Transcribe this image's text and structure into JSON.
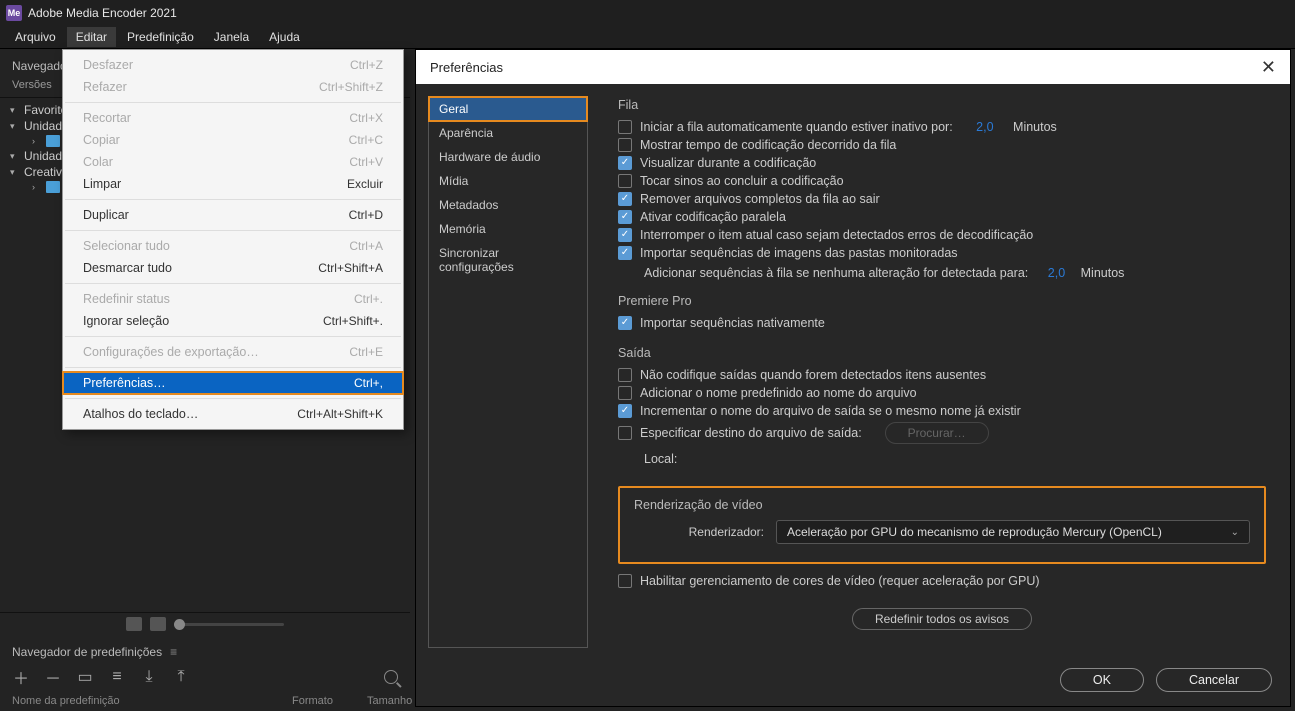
{
  "app": {
    "icon_text": "Me",
    "title": "Adobe Media Encoder 2021"
  },
  "menubar": [
    "Arquivo",
    "Editar",
    "Predefinição",
    "Janela",
    "Ajuda"
  ],
  "edit_menu": {
    "groups": [
      [
        {
          "label": "Desfazer",
          "shortcut": "Ctrl+Z",
          "disabled": true
        },
        {
          "label": "Refazer",
          "shortcut": "Ctrl+Shift+Z",
          "disabled": true
        }
      ],
      [
        {
          "label": "Recortar",
          "shortcut": "Ctrl+X",
          "disabled": true
        },
        {
          "label": "Copiar",
          "shortcut": "Ctrl+C",
          "disabled": true
        },
        {
          "label": "Colar",
          "shortcut": "Ctrl+V",
          "disabled": true
        },
        {
          "label": "Limpar",
          "shortcut": "Excluir",
          "disabled": false
        }
      ],
      [
        {
          "label": "Duplicar",
          "shortcut": "Ctrl+D",
          "disabled": false
        }
      ],
      [
        {
          "label": "Selecionar tudo",
          "shortcut": "Ctrl+A",
          "disabled": true
        },
        {
          "label": "Desmarcar tudo",
          "shortcut": "Ctrl+Shift+A",
          "disabled": false
        }
      ],
      [
        {
          "label": "Redefinir status",
          "shortcut": "Ctrl+.",
          "disabled": true
        },
        {
          "label": "Ignorar seleção",
          "shortcut": "Ctrl+Shift+.",
          "disabled": false
        }
      ],
      [
        {
          "label": "Configurações de exportação…",
          "shortcut": "Ctrl+E",
          "disabled": true
        }
      ],
      [
        {
          "label": "Preferências…",
          "shortcut": "Ctrl+,",
          "disabled": false,
          "highlight": true
        }
      ],
      [
        {
          "label": "Atalhos do teclado…",
          "shortcut": "Ctrl+Alt+Shift+K",
          "disabled": false
        }
      ]
    ]
  },
  "side": {
    "panel_title": "Navegador",
    "versions_label": "Versões",
    "tree": [
      {
        "label": "Favoritos",
        "caret": "▾"
      },
      {
        "label": "Unidades",
        "caret": "▾"
      },
      {
        "label": "",
        "caret": "›",
        "child": true,
        "icon": true
      },
      {
        "label": "Unidades",
        "caret": "▾"
      },
      {
        "label": "Creative",
        "caret": "▾"
      },
      {
        "label": "",
        "caret": "›",
        "child": true,
        "icon": true
      }
    ],
    "preset_browser_title": "Navegador de predefinições",
    "cols": {
      "name": "Nome da predefinição",
      "format": "Formato",
      "size": "Tamanho"
    }
  },
  "dialog": {
    "title": "Preferências",
    "categories": [
      "Geral",
      "Aparência",
      "Hardware de áudio",
      "Mídia",
      "Metadados",
      "Memória",
      "Sincronizar configurações"
    ],
    "selected_category": "Geral",
    "fila": {
      "heading": "Fila",
      "auto_start": {
        "label": "Iniciar a fila automaticamente quando estiver inativo por:",
        "value": "2,0",
        "unit": "Minutos",
        "checked": false
      },
      "show_elapsed": {
        "label": "Mostrar tempo de codificação decorrido da fila",
        "checked": false
      },
      "preview": {
        "label": "Visualizar durante a codificação",
        "checked": true
      },
      "sounds": {
        "label": "Tocar sinos ao concluir a codificação",
        "checked": false
      },
      "remove_done": {
        "label": "Remover arquivos completos da fila ao sair",
        "checked": true
      },
      "parallel": {
        "label": "Ativar codificação paralela",
        "checked": true
      },
      "stop_on_err": {
        "label": "Interromper o item atual caso sejam detectados erros de decodificação",
        "checked": true
      },
      "import_seq": {
        "label": "Importar sequências de imagens das pastas monitoradas",
        "checked": true
      },
      "add_seq_label": "Adicionar sequências à fila se nenhuma alteração for detectada para:",
      "add_seq_value": "2,0",
      "add_seq_unit": "Minutos"
    },
    "premiere": {
      "heading": "Premiere Pro",
      "native": {
        "label": "Importar sequências nativamente",
        "checked": true
      }
    },
    "saida": {
      "heading": "Saída",
      "no_encode_missing": {
        "label": "Não codifique saídas quando forem detectados itens ausentes",
        "checked": false
      },
      "add_preset_name": {
        "label": "Adicionar o nome predefinido ao nome do arquivo",
        "checked": false
      },
      "increment_name": {
        "label": "Incrementar o nome do arquivo de saída se o mesmo nome já existir",
        "checked": true
      },
      "specify_dest": {
        "label": "Especificar destino do arquivo de saída:",
        "checked": false
      },
      "browse_btn": "Procurar…",
      "local_label": "Local:"
    },
    "render": {
      "heading": "Renderização de vídeo",
      "label": "Renderizador:",
      "value": "Aceleração por GPU do mecanismo de reprodução Mercury (OpenCL)"
    },
    "color_mgmt": {
      "label": "Habilitar gerenciamento de cores de vídeo  (requer aceleração por GPU)",
      "checked": false
    },
    "reset_warnings": "Redefinir todos os avisos",
    "ok": "OK",
    "cancel": "Cancelar"
  }
}
